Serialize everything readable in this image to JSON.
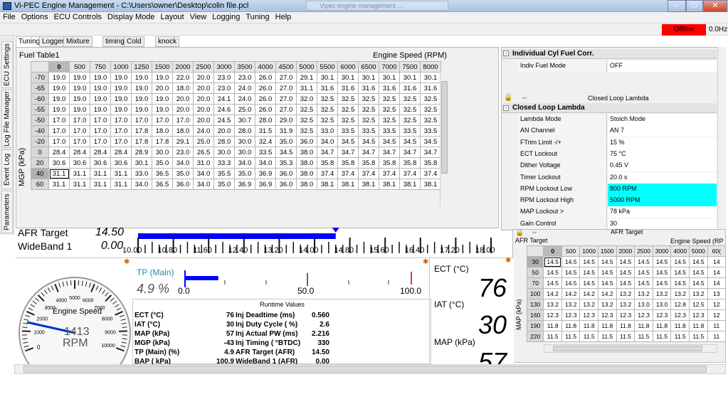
{
  "window": {
    "title": "Vi-PEC Engine Management - C:\\Users\\owner\\Desktop\\colin file.pcl",
    "faded_tab": "Vipec engine management ..."
  },
  "menu": [
    "File",
    "Options",
    "ECU Controls",
    "Display Mode",
    "Layout",
    "View",
    "Logging",
    "Tuning",
    "Help"
  ],
  "status": {
    "offline": "Offline",
    "rate": "0.0Hz"
  },
  "side_tabs": [
    "ECU Settings",
    "Log File Manager",
    "Event Log",
    "Parameters"
  ],
  "tabs": [
    "Tuning",
    "Logger",
    "Mixture Map",
    "timing",
    "Cold start",
    "knock"
  ],
  "fuel_table": {
    "title": "Fuel Table1",
    "x_axis_label": "Engine Speed (RPM)",
    "y_axis_label": "MGP (kPa)",
    "columns": [
      "0",
      "500",
      "750",
      "1000",
      "1250",
      "1500",
      "2000",
      "2500",
      "3000",
      "3500",
      "4000",
      "4500",
      "5000",
      "5500",
      "6000",
      "6500",
      "7000",
      "7500",
      "8000"
    ],
    "rows": [
      {
        "label": "-70",
        "cells": [
          "19.0",
          "19.0",
          "19.0",
          "19.0",
          "19.0",
          "19.0",
          "22.0",
          "20.0",
          "23.0",
          "23.0",
          "26.0",
          "27.0",
          "29.1",
          "30.1",
          "30.1",
          "30.1",
          "30.1",
          "30.1",
          "30.1"
        ]
      },
      {
        "label": "-65",
        "cells": [
          "19.0",
          "19.0",
          "19.0",
          "19.0",
          "19.0",
          "20.0",
          "18.0",
          "20.0",
          "23.0",
          "24.0",
          "26.0",
          "27.0",
          "31.1",
          "31.6",
          "31.6",
          "31.6",
          "31.6",
          "31.6",
          "31.6"
        ]
      },
      {
        "label": "-60",
        "cells": [
          "19.0",
          "19.0",
          "19.0",
          "19.0",
          "19.0",
          "19.0",
          "20.0",
          "20.0",
          "24.1",
          "24.0",
          "26.0",
          "27.0",
          "32.0",
          "32.5",
          "32.5",
          "32.5",
          "32.5",
          "32.5",
          "32.5"
        ]
      },
      {
        "label": "-55",
        "cells": [
          "19.0",
          "19.0",
          "19.0",
          "19.0",
          "19.0",
          "19.0",
          "20.0",
          "20.0",
          "24.6",
          "25.0",
          "26.0",
          "27.0",
          "32.5",
          "32.5",
          "32.5",
          "32.5",
          "32.5",
          "32.5",
          "32.5"
        ]
      },
      {
        "label": "-50",
        "cells": [
          "17.0",
          "17.0",
          "17.0",
          "17.0",
          "17.0",
          "17.0",
          "17.0",
          "20.0",
          "24.5",
          "30.7",
          "28.0",
          "29.0",
          "32.5",
          "32.5",
          "32.5",
          "32.5",
          "32.5",
          "32.5",
          "32.5"
        ]
      },
      {
        "label": "-40",
        "cells": [
          "17.0",
          "17.0",
          "17.0",
          "17.0",
          "17.8",
          "18.0",
          "18.0",
          "24.0",
          "20.0",
          "28.0",
          "31.5",
          "31.9",
          "32.5",
          "33.0",
          "33.5",
          "33.5",
          "33.5",
          "33.5",
          "33.5"
        ]
      },
      {
        "label": "-20",
        "cells": [
          "17.0",
          "17.0",
          "17.0",
          "17.0",
          "17.8",
          "17.8",
          "29.1",
          "25.0",
          "28.0",
          "30.0",
          "32.4",
          "35.0",
          "36.0",
          "34.0",
          "34.5",
          "34.5",
          "34.5",
          "34.5",
          "34.5"
        ]
      },
      {
        "label": "0",
        "cells": [
          "28.4",
          "28.4",
          "28.4",
          "28.4",
          "28.9",
          "30.0",
          "23.0",
          "26.5",
          "30.0",
          "30.0",
          "33.5",
          "34.5",
          "38.0",
          "34.7",
          "34.7",
          "34.7",
          "34.7",
          "34.7",
          "34.7"
        ]
      },
      {
        "label": "20",
        "cells": [
          "30.6",
          "30.6",
          "30.6",
          "30.6",
          "30.1",
          "35.0",
          "34.0",
          "31.0",
          "33.3",
          "34.0",
          "34.0",
          "35.3",
          "38.0",
          "35.8",
          "35.8",
          "35.8",
          "35.8",
          "35.8",
          "35.8"
        ]
      },
      {
        "label": "40",
        "cells": [
          "31.1",
          "31.1",
          "31.1",
          "31.1",
          "33.0",
          "36.5",
          "35.0",
          "34.0",
          "35.5",
          "35.0",
          "36.9",
          "36.0",
          "38.0",
          "37.4",
          "37.4",
          "37.4",
          "37.4",
          "37.4",
          "37.4"
        ]
      },
      {
        "label": "60",
        "cells": [
          "31.1",
          "31.1",
          "31.1",
          "31.1",
          "34.0",
          "36.5",
          "36.0",
          "34.0",
          "35.0",
          "36.9",
          "36.9",
          "36.0",
          "38.0",
          "38.1",
          "38.1",
          "38.1",
          "38.1",
          "38.1",
          "38.1"
        ]
      }
    ]
  },
  "indiv": {
    "header": "Individual Cyl Fuel Corr.",
    "rows": [
      {
        "key": "Indiv Fuel Mode",
        "value": "OFF"
      }
    ]
  },
  "closed_loop": {
    "toolbar_title": "Closed Loop Lambda",
    "header": "Closed Loop Lambda",
    "rows": [
      {
        "key": "Lambda Mode",
        "value": "Stoich Mode",
        "hl": false
      },
      {
        "key": "AN Channel",
        "value": "AN 7",
        "hl": false
      },
      {
        "key": "FTrim Limit -/+",
        "value": "15 %",
        "hl": false
      },
      {
        "key": "ECT Lockout",
        "value": "75 °C",
        "hl": false
      },
      {
        "key": "Dither Voltage",
        "value": "0.45 V",
        "hl": false
      },
      {
        "key": "Timer Lockout",
        "value": "20.0 s",
        "hl": false
      },
      {
        "key": "RPM Lockout Low",
        "value": "800 RPM",
        "hl": true
      },
      {
        "key": "RPM Lockout High",
        "value": "5000 RPM",
        "hl": true
      },
      {
        "key": "MAP Lockout >",
        "value": "78 kPa",
        "hl": false
      },
      {
        "key": "Gain Control",
        "value": "30",
        "hl": false
      }
    ]
  },
  "afr_bar": {
    "label1": "AFR Target",
    "value1": "14.50",
    "label2": "WideBand 1",
    "value2": "0.00",
    "scale": [
      "10.00",
      "10.80",
      "11.60",
      "12.40",
      "13.20",
      "14.00",
      "14.80",
      "15.60",
      "16.40",
      "17.20",
      "18.00"
    ],
    "fill_fraction": 0.56
  },
  "tach": {
    "label": "Engine Speed",
    "value": "1413",
    "unit": "RPM",
    "ticks": [
      "1000",
      "2000",
      "3000",
      "4000",
      "5000",
      "6000",
      "7000",
      "8000",
      "9000",
      "10000"
    ],
    "zero": "0"
  },
  "tp": {
    "label": "TP (Main)",
    "value": "4.9 %",
    "scale": [
      "0.0",
      "50.0",
      "100.0"
    ],
    "fill_fraction": 0.049
  },
  "runtime": {
    "title": "Runtime Values",
    "left": [
      {
        "k": "ECT (°C)",
        "v": "76"
      },
      {
        "k": "IAT (°C)",
        "v": "30"
      },
      {
        "k": "MAP (kPa)",
        "v": "57"
      },
      {
        "k": "MGP (kPa)",
        "v": "-43"
      },
      {
        "k": "TP (Main) (%)",
        "v": "4.9"
      },
      {
        "k": "BAP ( kPa)",
        "v": "100.9"
      }
    ],
    "right": [
      {
        "k": "Inj Deadtime (ms)",
        "v": "0.560"
      },
      {
        "k": "Inj Duty Cycle ( %)",
        "v": "2.6"
      },
      {
        "k": "Inj Actual PW (ms)",
        "v": "2.216"
      },
      {
        "k": "Inj Timing ( °BTDC)",
        "v": "330"
      },
      {
        "k": "AFR Target (AFR)",
        "v": "14.50"
      },
      {
        "k": "WideBand 1 (AFR)",
        "v": "0.00"
      }
    ]
  },
  "digital": [
    {
      "label": "ECT (°C)",
      "value": "76"
    },
    {
      "label": "IAT (°C)",
      "value": "30"
    },
    {
      "label": "MAP (kPa)",
      "value": "57"
    }
  ],
  "afr_table": {
    "title": "AFR Target",
    "header_partial": "AFR Target",
    "x_axis_label": "Engine Speed (RP",
    "y_axis_label": "MAP (kPa)",
    "columns": [
      "0",
      "500",
      "1000",
      "1500",
      "2000",
      "2500",
      "3000",
      "4000",
      "5000",
      "60("
    ],
    "rows": [
      {
        "label": "30",
        "cells": [
          "14.5",
          "14.5",
          "14.5",
          "14.5",
          "14.5",
          "14.5",
          "14.5",
          "14.5",
          "14.5",
          "14"
        ]
      },
      {
        "label": "50",
        "cells": [
          "14.5",
          "14.5",
          "14.5",
          "14.5",
          "14.5",
          "14.5",
          "14.5",
          "14.5",
          "14.5",
          "14"
        ]
      },
      {
        "label": "70",
        "cells": [
          "14.5",
          "14.5",
          "14.5",
          "14.5",
          "14.5",
          "14.5",
          "14.5",
          "14.5",
          "14.5",
          "14"
        ]
      },
      {
        "label": "100",
        "cells": [
          "14.2",
          "14.2",
          "14.2",
          "14.2",
          "13.2",
          "13.2",
          "13.2",
          "13.2",
          "13.2",
          "13"
        ]
      },
      {
        "label": "130",
        "cells": [
          "13.2",
          "13.2",
          "13.2",
          "13.2",
          "13.2",
          "13.0",
          "13.0",
          "12.8",
          "12.5",
          "12"
        ]
      },
      {
        "label": "160",
        "cells": [
          "12.3",
          "12.3",
          "12.3",
          "12.3",
          "12.3",
          "12.3",
          "12.3",
          "12.3",
          "12.3",
          "12"
        ]
      },
      {
        "label": "190",
        "cells": [
          "11.8",
          "11.8",
          "11.8",
          "11.8",
          "11.8",
          "11.8",
          "11.8",
          "11.8",
          "11.8",
          "11"
        ]
      },
      {
        "label": "220",
        "cells": [
          "11.5",
          "11.5",
          "11.5",
          "11.5",
          "11.5",
          "11.5",
          "11.5",
          "11.5",
          "11.5",
          "11"
        ]
      }
    ]
  },
  "colors": {
    "offline": "#ff0000",
    "highlight": "#00ffff",
    "bar": "#0000ff",
    "accent_orange": "#e07a00"
  }
}
